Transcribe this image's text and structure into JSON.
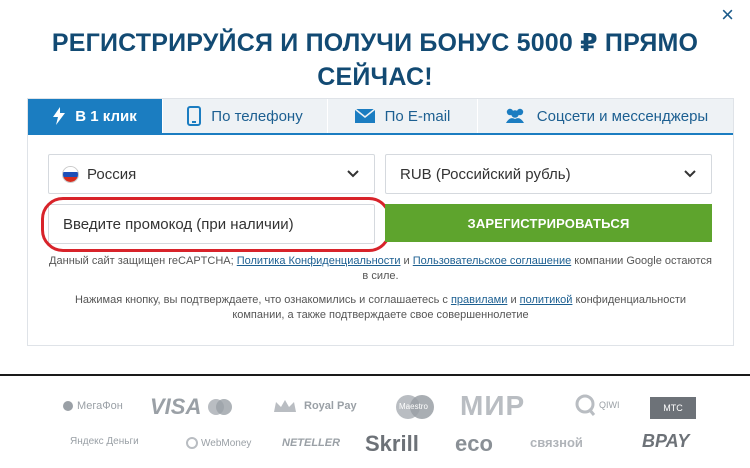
{
  "title_line1": "РЕГИСТРИРУЙСЯ И ПОЛУЧИ БОНУС 5000 ₽ ПРЯМО",
  "title_line2": "СЕЙЧАС!",
  "close_label": "×",
  "tabs": [
    {
      "label": "В 1 клик",
      "icon": "lightning-icon",
      "active": true
    },
    {
      "label": "По телефону",
      "icon": "phone-icon",
      "active": false
    },
    {
      "label": "По E-mail",
      "icon": "envelope-icon",
      "active": false
    },
    {
      "label": "Соцсети и мессенджеры",
      "icon": "users-icon",
      "active": false
    }
  ],
  "country": {
    "value": "Россия"
  },
  "currency": {
    "value": "RUB (Российский рубль)"
  },
  "promo": {
    "placeholder": "Введите промокод (при наличии)"
  },
  "register_label": "ЗАРЕГИСТРИРОВАТЬСЯ",
  "recaptcha": {
    "pre": "Данный сайт защищен reCAPTCHA;",
    "link1": "Политика Конфиденциальности",
    "mid": "и",
    "link2": "Пользовательское соглашение",
    "post": "компании Google остаются в силе."
  },
  "terms": {
    "pre": "Нажимая кнопку, вы подтверждаете, что ознакомились и соглашаетесь с",
    "link1": "правилами",
    "mid": "и",
    "link2": "политикой",
    "post": "конфиденциальности компании, а также подтверждаете свое совершеннолетие"
  },
  "payment_logos": [
    {
      "name": "megafon",
      "label": "МегаФон"
    },
    {
      "name": "visa",
      "label": "VISA"
    },
    {
      "name": "royal-pay",
      "label": "Royal Pay"
    },
    {
      "name": "maestro",
      "label": "Maestro"
    },
    {
      "name": "mir",
      "label": "МИР"
    },
    {
      "name": "qiwi",
      "label": "QIWI"
    },
    {
      "name": "mts",
      "label": "МТС"
    },
    {
      "name": "yandex-money",
      "label": "Яндекс Деньги"
    },
    {
      "name": "webmoney",
      "label": "WebMoney"
    },
    {
      "name": "neteller",
      "label": "NETELLER"
    },
    {
      "name": "skrill",
      "label": "Skrill"
    },
    {
      "name": "eco",
      "label": "eco"
    },
    {
      "name": "svyaznoy",
      "label": "связной"
    },
    {
      "name": "bpay",
      "label": "BPAY"
    }
  ],
  "colors": {
    "accent": "#1b7dc1",
    "title": "#124a73",
    "register": "#5ea42d",
    "highlight": "#d8232a"
  }
}
